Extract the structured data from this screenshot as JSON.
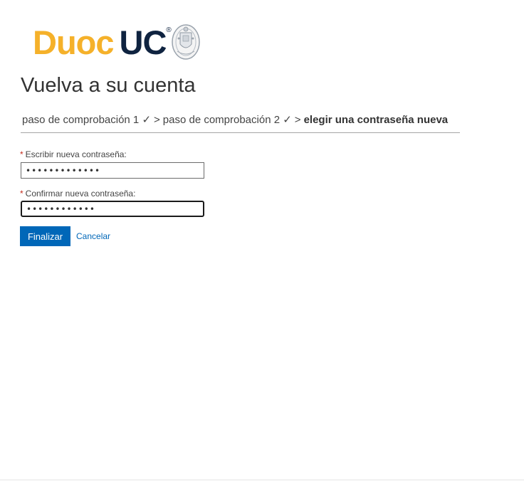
{
  "logo": {
    "part1": "Duoc",
    "part2": "UC",
    "registered": "®",
    "seal_icon": "university-seal-icon",
    "colors": {
      "duoc": "#f5b12a",
      "uc": "#0f2340"
    }
  },
  "title": "Vuelva a su cuenta",
  "breadcrumb": {
    "step1": "paso de comprobación 1 ✓",
    "step2": "paso de comprobación 2 ✓",
    "separator": ">",
    "current": "elegir una contraseña nueva"
  },
  "form": {
    "required_mark": "*",
    "new_password_label": "Escribir nueva contraseña:",
    "new_password_value": "•••••••••••••",
    "confirm_password_label": "Confirmar nueva contraseña:",
    "confirm_password_value": "••••••••••••",
    "finish_button": "Finalizar",
    "cancel_link": "Cancelar"
  },
  "colors": {
    "accent": "#0067b8",
    "required": "#c42b1c"
  }
}
